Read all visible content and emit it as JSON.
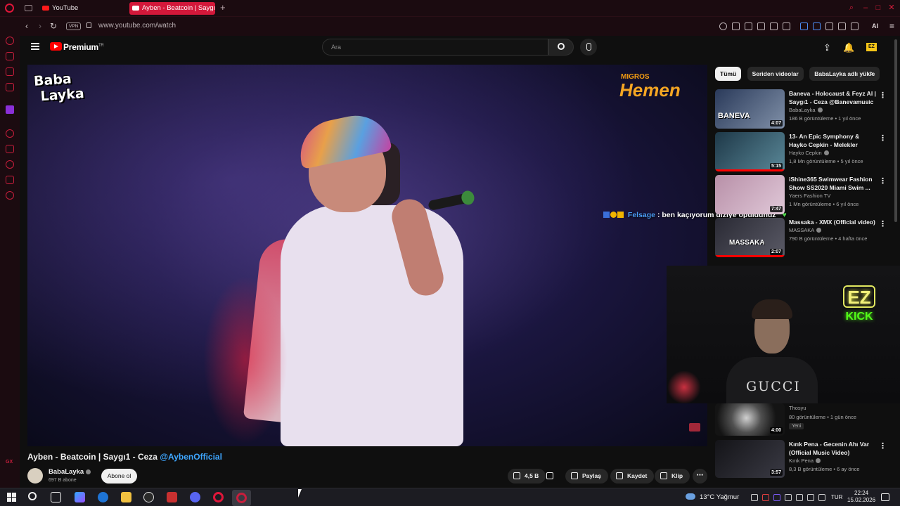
{
  "browser": {
    "tabs": [
      {
        "label": "YouTube",
        "active": false
      },
      {
        "label": "Ayben - Beatcoin | Saygı1 - Ceza",
        "active": true
      }
    ],
    "new_tab": "+",
    "url": "www.youtube.com/watch",
    "vpn_label": "VPN",
    "ai_label": "AI",
    "accent": "#d3183a"
  },
  "yt": {
    "brand": "Premium",
    "brand_region": "TR",
    "search_placeholder": "Ara"
  },
  "player": {
    "channel_logo_line1": "Baba",
    "channel_logo_line2": "Layka",
    "sponsor_line1": "MIGROS",
    "sponsor_line2": "Hemen"
  },
  "chat": {
    "user": "Felsage",
    "message": ": ben kaçıyorum diziye opuldünüz",
    "heart": "♥"
  },
  "video": {
    "title": "Ayben - Beatcoin | Saygı1 - Ceza",
    "mention": "@AybenOfficial",
    "channel": "BabaLayka",
    "subscribers": "697 B abone",
    "subscribe_label": "Abone ol",
    "likes": "4,5 B",
    "share_label": "Paylaş",
    "save_label": "Kaydet",
    "clip_label": "Klip",
    "more": "⋯"
  },
  "chips": [
    "Tümü",
    "Seriden videolar",
    "BabaLayka adlı yükle"
  ],
  "recommendations": [
    {
      "title": "Baneva - Holocaust & Feyz Al | Saygı1 - Ceza @Banevamusic",
      "channel": "BabaLayka",
      "meta": "186 B görüntüleme • 1 yıl önce",
      "duration": "4:07",
      "thumb_text": "BANEVA",
      "thumb_color": "#3a4a6a",
      "progress": 1.0
    },
    {
      "title": "13- An Epic Symphony & Hayko Cepkin - Melekler",
      "channel": "Hayko Cepkin",
      "meta": "1,8 Mn görüntüleme • 5 yıl önce",
      "duration": "5:15",
      "thumb_text": "",
      "thumb_color": "#2a4a5a",
      "progress": 1.0
    },
    {
      "title": "iShine365 Swimwear Fashion Show SS2020 Miami Swim ...",
      "channel": "Yaers Fashion TV",
      "meta": "1 Mn görüntüleme • 6 yıl önce",
      "duration": "7:47",
      "thumb_text": "",
      "thumb_color": "#c8a0b8",
      "progress": 0
    },
    {
      "title": "Massaka - XMX (Official video)",
      "channel": "MASSAKA",
      "meta": "790 B görüntüleme • 4 hafta önce",
      "duration": "2:07",
      "thumb_text": "MASSAKA",
      "thumb_color": "#3a3a44",
      "progress": 1.0
    },
    {
      "title": "",
      "channel": "Thosyu",
      "meta": "80 görüntüleme • 1 gün önce",
      "duration": "4:00",
      "thumb_text": "",
      "thumb_color": "#2a2a2a",
      "progress": 0,
      "badge": "Yeni"
    },
    {
      "title": "Kırık Pena - Gecenin Ahı Var (Official Music Video)",
      "channel": "Kırık Pena",
      "meta": "8,3 B görüntüleme • 6 ay önce",
      "duration": "3:57",
      "thumb_text": "",
      "thumb_color": "#1e1e22",
      "progress": 0
    }
  ],
  "webcam": {
    "shirt_text": "GUCCI",
    "neon_top": "EZ",
    "neon_bottom": "KICK"
  },
  "taskbar": {
    "weather": "13°C  Yağmur",
    "lang": "TUR",
    "time": "22:24",
    "date": "15.02.2026"
  }
}
